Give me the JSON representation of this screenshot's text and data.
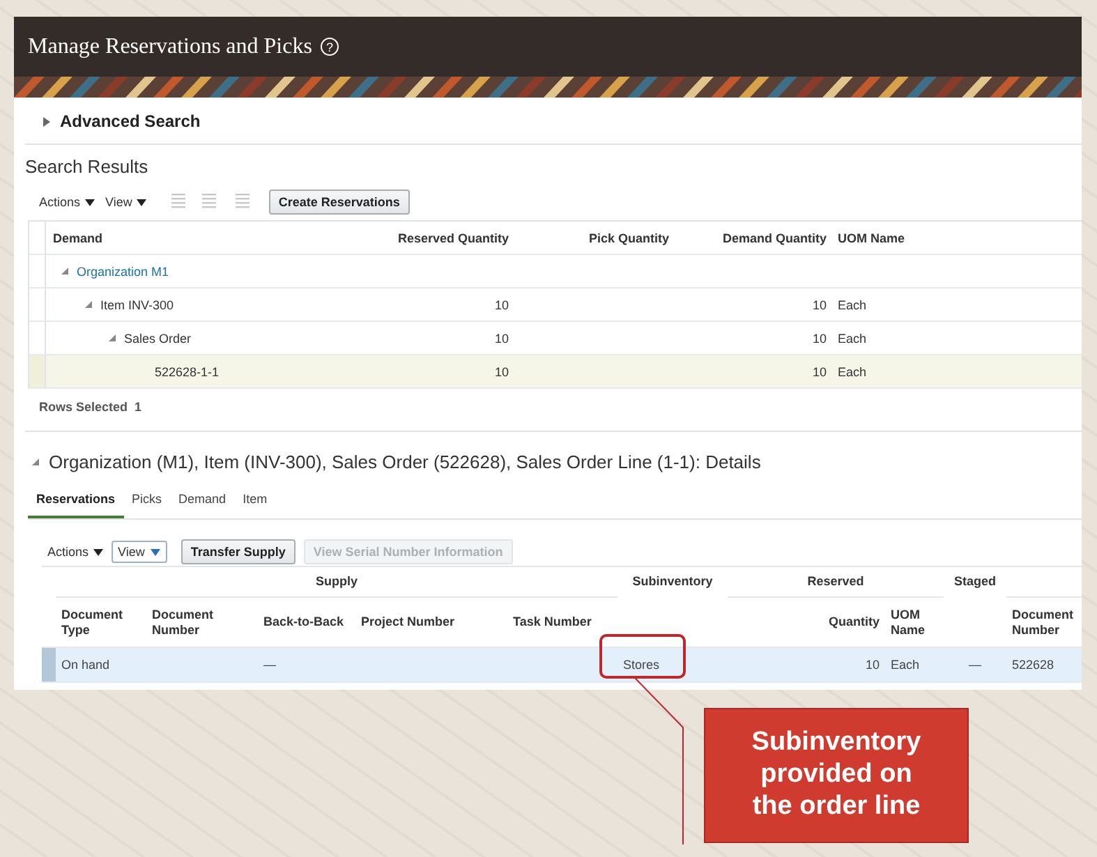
{
  "header": {
    "title": "Manage Reservations and Picks",
    "help": "?"
  },
  "advanced_search": {
    "label": "Advanced Search",
    "expanded": false
  },
  "search_results": {
    "title": "Search Results",
    "toolbar": {
      "menus": [
        "Actions",
        "View"
      ],
      "button": "Create Reservations"
    },
    "columns": [
      "Demand",
      "Reserved Quantity",
      "Pick Quantity",
      "Demand Quantity",
      "UOM Name"
    ],
    "rows": [
      {
        "demand": "Organization M1",
        "kind": "link",
        "expanded": true,
        "selected": false,
        "children": [
          {
            "demand": "Item INV-300",
            "kind": "text",
            "expanded": true,
            "selected": false,
            "reserved": "10",
            "demand_qty": "10",
            "uom": "Each",
            "children": [
              {
                "demand": "Sales Order",
                "kind": "text",
                "expanded": true,
                "selected": false,
                "reserved": "10",
                "demand_qty": "10",
                "uom": "Each",
                "children": [
                  {
                    "demand": "522628-1-1",
                    "kind": "text",
                    "selected": true,
                    "reserved": "10",
                    "demand_qty": "10",
                    "uom": "Each"
                  }
                ]
              }
            ]
          }
        ]
      }
    ],
    "rows_selected": {
      "label": "Rows Selected",
      "value": "1"
    }
  },
  "details": {
    "title": "Organization (M1), Item (INV-300), Sales Order (522628), Sales Order Line (1-1): Details",
    "expanded": true,
    "tabs": [
      {
        "label": "Reservations",
        "selected": true
      },
      {
        "label": "Picks",
        "selected": false
      },
      {
        "label": "Demand",
        "selected": false
      },
      {
        "label": "Item",
        "selected": false
      }
    ],
    "toolbar": {
      "actions": "Actions",
      "view": "View",
      "buttons": [
        {
          "label": "Transfer Supply",
          "disabled": false
        },
        {
          "label": "View Serial Number Information",
          "disabled": true
        }
      ]
    },
    "groups": [
      "Supply",
      "Reserved"
    ],
    "columns": [
      "Document Type",
      "Document Number",
      "Back-to-Back",
      "Project Number",
      "Task Number",
      "Subinventory",
      "Quantity",
      "UOM Name",
      "Staged",
      "Document Number"
    ],
    "rows": [
      {
        "selected": true,
        "document_type": "On hand",
        "back_to_back": "—",
        "subinventory": "Stores",
        "quantity": "10",
        "uom": "Each",
        "staged": "—",
        "document_number": "522628"
      }
    ]
  },
  "callout": {
    "text": "Subinventory provided on the order line"
  }
}
